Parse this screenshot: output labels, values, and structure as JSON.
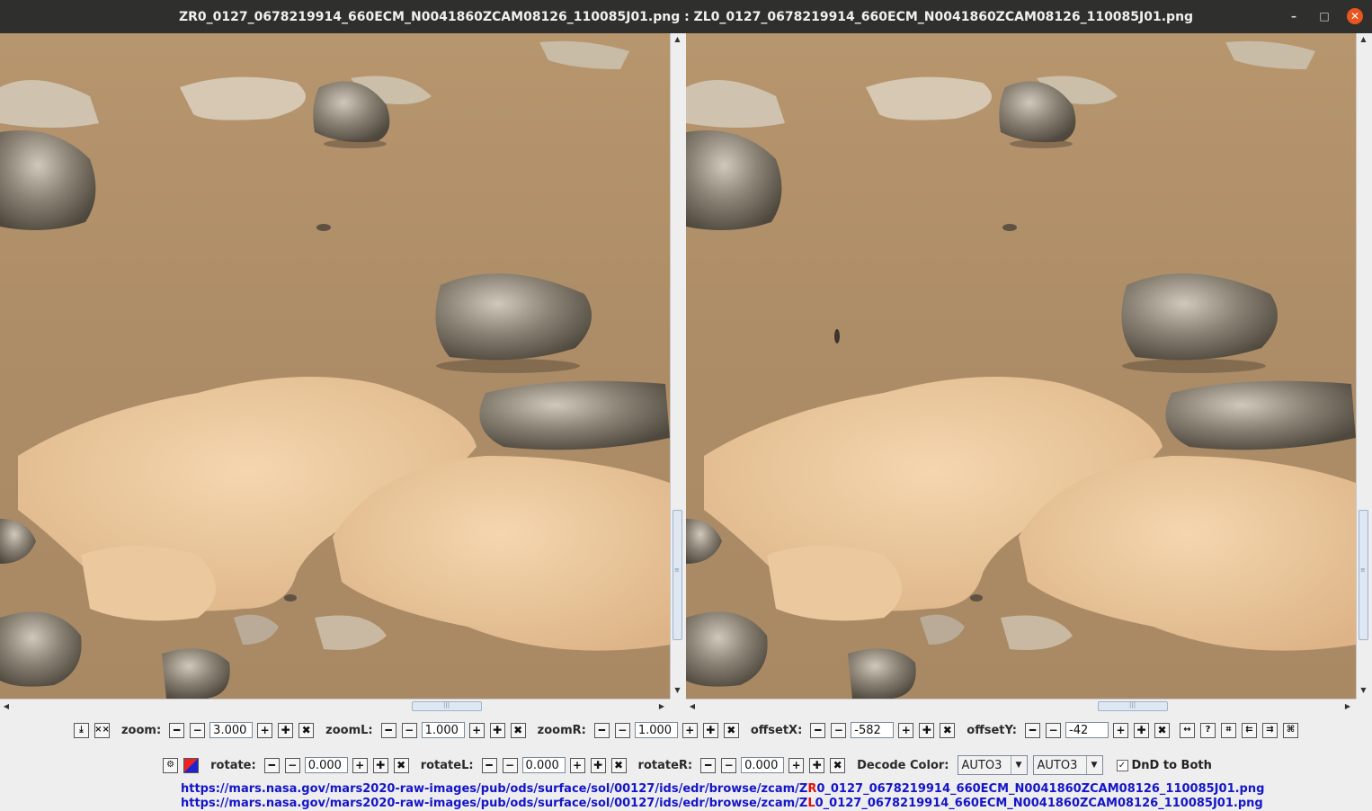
{
  "window": {
    "title": "ZR0_0127_0678219914_660ECM_N0041860ZCAM08126_110085J01.png : ZL0_0127_0678219914_660ECM_N0041860ZCAM08126_110085J01.png",
    "minimize_glyph": "–",
    "maximize_glyph": "□",
    "close_glyph": "✕"
  },
  "toolbar1": {
    "zoom_label": "zoom:",
    "zoom_value": "3.000",
    "zoomL_label": "zoomL:",
    "zoomL_value": "1.000",
    "zoomR_label": "zoomR:",
    "zoomR_value": "1.000",
    "offsetX_label": "offsetX:",
    "offsetX_value": "-582",
    "offsetY_label": "offsetY:",
    "offsetY_value": "-42",
    "icons": [
      "save-icon",
      "swap-icon",
      "help-icon",
      "fit-icon",
      "left-align-icon",
      "right-align-icon",
      "center-icon"
    ]
  },
  "toolbar2": {
    "rotate_label": "rotate:",
    "rotate_value": "0.000",
    "rotateL_label": "rotateL:",
    "rotateL_value": "0.000",
    "rotateR_label": "rotateR:",
    "rotateR_value": "0.000",
    "decode_label": "Decode Color:",
    "decode_left": "AUTO3",
    "decode_right": "AUTO3",
    "dnd_label": "DnD to Both",
    "dnd_checked": true
  },
  "links": {
    "right_prefix": "https://mars.nasa.gov/mars2020-raw-images/pub/ods/surface/sol/00127/ids/edr/browse/zcam/Z",
    "right_marker": "R",
    "right_suffix": "0_0127_0678219914_660ECM_N0041860ZCAM08126_110085J01.png",
    "left_prefix": "https://mars.nasa.gov/mars2020-raw-images/pub/ods/surface/sol/00127/ids/edr/browse/zcam/Z",
    "left_marker": "L",
    "left_suffix": "0_0127_0678219914_660ECM_N0041860ZCAM08126_110085J01.png"
  },
  "colors": {
    "sand": "#b4936d",
    "light_rock": "#e6c197",
    "dark_rock": "#6b6457",
    "link": "#1515c8",
    "marker": "#e01010"
  }
}
